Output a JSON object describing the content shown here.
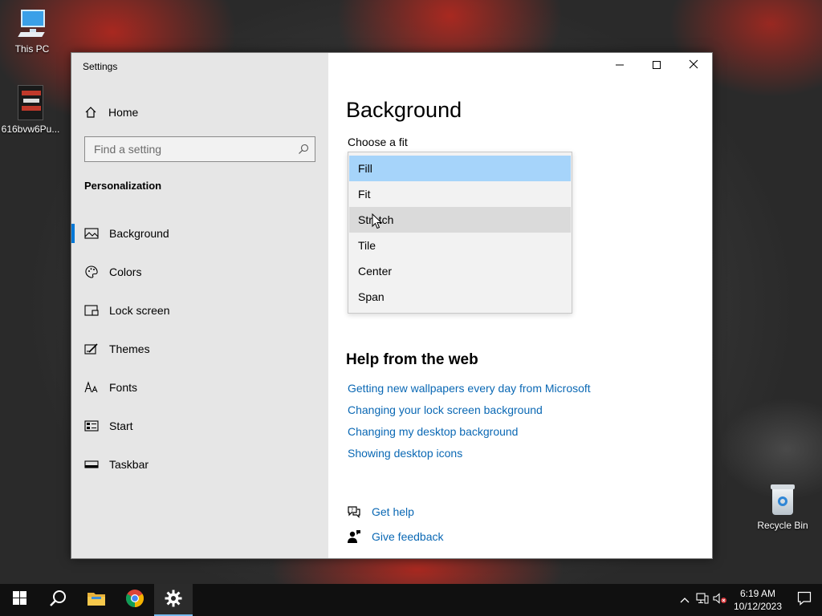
{
  "desktop": {
    "icons": [
      {
        "label": "This PC"
      },
      {
        "label": "616bvw6Pu..."
      },
      {
        "label": "Recycle Bin"
      }
    ]
  },
  "window": {
    "title": "Settings",
    "caption": {
      "minimize": "–",
      "maximize": "□",
      "close": "✕"
    }
  },
  "sidebar": {
    "home_label": "Home",
    "search_placeholder": "Find a setting",
    "section_title": "Personalization",
    "items": [
      {
        "label": "Background",
        "icon": "picture-icon",
        "active": true
      },
      {
        "label": "Colors",
        "icon": "palette-icon"
      },
      {
        "label": "Lock screen",
        "icon": "lock-screen-icon"
      },
      {
        "label": "Themes",
        "icon": "themes-icon"
      },
      {
        "label": "Fonts",
        "icon": "fonts-icon"
      },
      {
        "label": "Start",
        "icon": "start-icon"
      },
      {
        "label": "Taskbar",
        "icon": "taskbar-icon"
      }
    ]
  },
  "main": {
    "title": "Background",
    "fit_label": "Choose a fit",
    "fit_options": [
      {
        "label": "Fill",
        "state": "selected"
      },
      {
        "label": "Fit"
      },
      {
        "label": "Stretch",
        "state": "hover"
      },
      {
        "label": "Tile"
      },
      {
        "label": "Center"
      },
      {
        "label": "Span"
      }
    ],
    "help_title": "Help from the web",
    "help_links": [
      "Getting new wallpapers every day from Microsoft",
      "Changing your lock screen background",
      "Changing my desktop background",
      "Showing desktop icons"
    ],
    "get_help": "Get help",
    "give_feedback": "Give feedback"
  },
  "taskbar": {
    "apps": [
      "start-icon",
      "search-icon",
      "file-explorer-icon",
      "chrome-icon",
      "settings-icon"
    ],
    "active_app": "settings-icon",
    "time": "6:19 AM",
    "date": "10/12/2023"
  }
}
